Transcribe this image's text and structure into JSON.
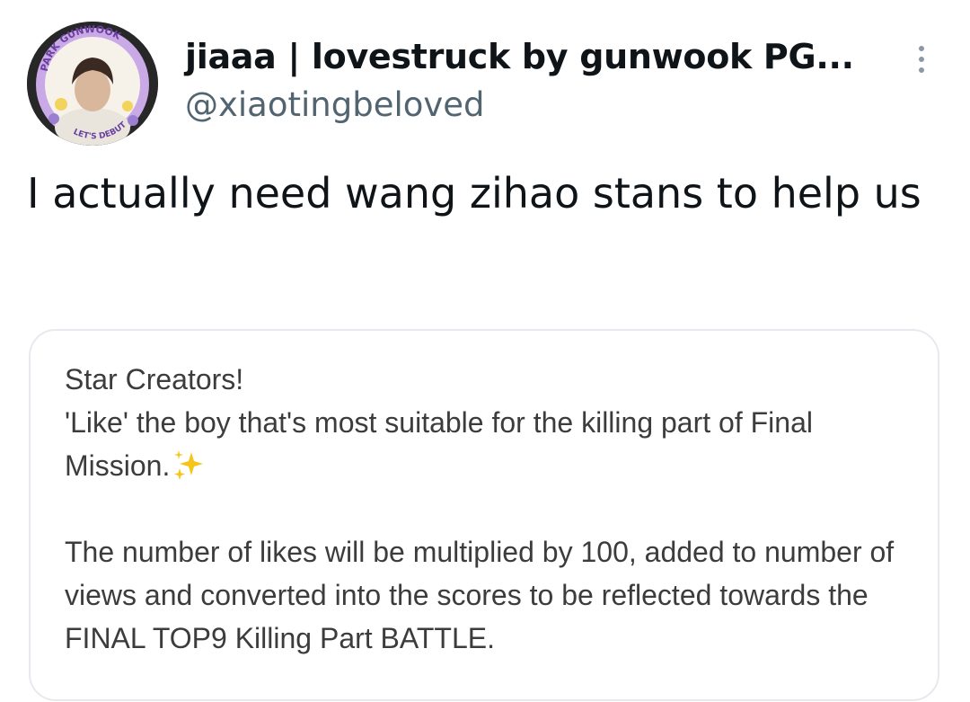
{
  "author": {
    "display_name": "jiaaa | lovestruck by gunwook PG...",
    "handle": "@xiaotingbeloved",
    "avatar_icon": "profile-avatar",
    "avatar_banner_text": "PARK GUNWOOK",
    "avatar_badge_text": "LET'S DEBUT"
  },
  "more_icon": "more-vertical-icon",
  "tweet": {
    "text": "I actually need wang zihao stans to help us"
  },
  "quote": {
    "line1": "Star Creators!",
    "line2": "'Like' the boy that's most suitable for the killing part of Final Mission.",
    "emoji_icon": "sparkles-icon",
    "paragraph2": "The number of likes will be multiplied by 100, added to number of views and converted into the scores to be reflected towards the FINAL TOP9 Killing Part BATTLE."
  },
  "colors": {
    "text": "#0f1419",
    "secondary_text": "#536471",
    "quote_text": "#3c3c3c",
    "card_border": "#e6eaee",
    "sparkle": "#f5c518"
  }
}
